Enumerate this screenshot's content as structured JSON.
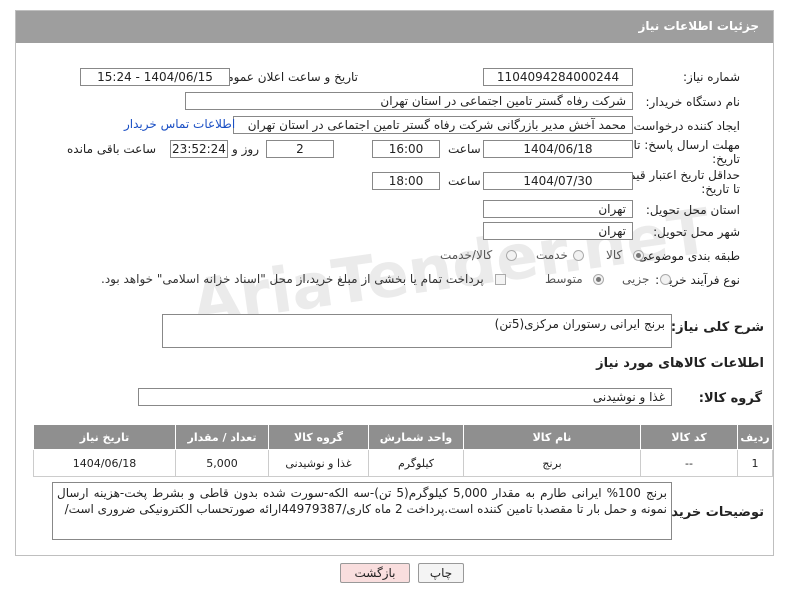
{
  "header": {
    "title": "جزئیات اطلاعات نیاز"
  },
  "form": {
    "need_number_label": "شماره نیاز:",
    "need_number": "1104094284000244",
    "announce_label": "تاریخ و ساعت اعلان عمومی:",
    "announce_value": "1404/06/15 - 15:24",
    "buyer_org_label": "نام دستگاه خریدار:",
    "buyer_org": "شرکت رفاه گستر تامین اجتماعی در استان تهران",
    "creator_label": "ایجاد کننده درخواست:",
    "creator": "محمد آخش مدیر بازرگانی شرکت رفاه گستر تامین اجتماعی در استان تهران",
    "contact_link": "اطلاعات تماس خریدار",
    "deadline_label_1": "مهلت ارسال پاسخ: تا",
    "deadline_label_2": "تاریخ:",
    "deadline_date": "1404/06/18",
    "time_label": "ساعت",
    "deadline_time": "16:00",
    "days_value": "2",
    "days_label": "روز و",
    "remaining_time": "23:52:24",
    "remaining_label": "ساعت باقی مانده",
    "price_validity_label_1": "حداقل تاریخ اعتبار قیمت:",
    "price_validity_label_2": "تا تاریخ:",
    "price_validity_date": "1404/07/30",
    "price_validity_time": "18:00",
    "delivery_province_label": "استان محل تحویل:",
    "delivery_province": "تهران",
    "delivery_city_label": "شهر محل تحویل:",
    "delivery_city": "تهران",
    "category_label": "طبقه بندی موضوعی:",
    "category_options": [
      "کالا",
      "خدمت",
      "کالا/خدمت"
    ],
    "purchase_type_label": "نوع فرآیند خرید :",
    "purchase_type_options": [
      "جزیی",
      "متوسط"
    ],
    "payment_note": "پرداخت تمام یا بخشی از مبلغ خرید،از محل \"اسناد خزانه اسلامی\" خواهد بود.",
    "description_label": "شرح کلی نیاز:",
    "description": "برنج ایرانی رستوران مرکزی(5تن)",
    "goods_info_title": "اطلاعات کالاهای مورد نیاز",
    "goods_group_label": "گروه کالا:",
    "goods_group": "غذا و نوشیدنی"
  },
  "table": {
    "headers": [
      "ردیف",
      "کد کالا",
      "نام کالا",
      "واحد شمارش",
      "گروه کالا",
      "تعداد / مقدار",
      "تاریخ نیاز"
    ],
    "rows": [
      [
        "1",
        "--",
        "برنج",
        "کیلوگرم",
        "غذا و نوشیدنی",
        "5,000",
        "1404/06/18"
      ]
    ]
  },
  "buyer_notes_label": "توضیحات خریدار:",
  "buyer_notes": "برنج 100% ایرانی طارم به مقدار 5,000 کیلوگرم(5 تن)-سه الکه-سورت شده بدون قاطی و بشرط پخت-هزینه ارسال نمونه و حمل بار تا مقصدبا تامین کننده است.پرداخت 2 ماه کاری/44979387ارائه صورتحساب الکترونیکی ضروری است/",
  "buttons": {
    "print": "چاپ",
    "back": "بازگشت"
  },
  "watermark": "AriaTender.neT",
  "colors": {
    "header_bg": "#9e9e9e",
    "table_header_bg": "#8f8f8f",
    "back_button_bg": "#f9dede",
    "link": "#1a4fc4"
  }
}
